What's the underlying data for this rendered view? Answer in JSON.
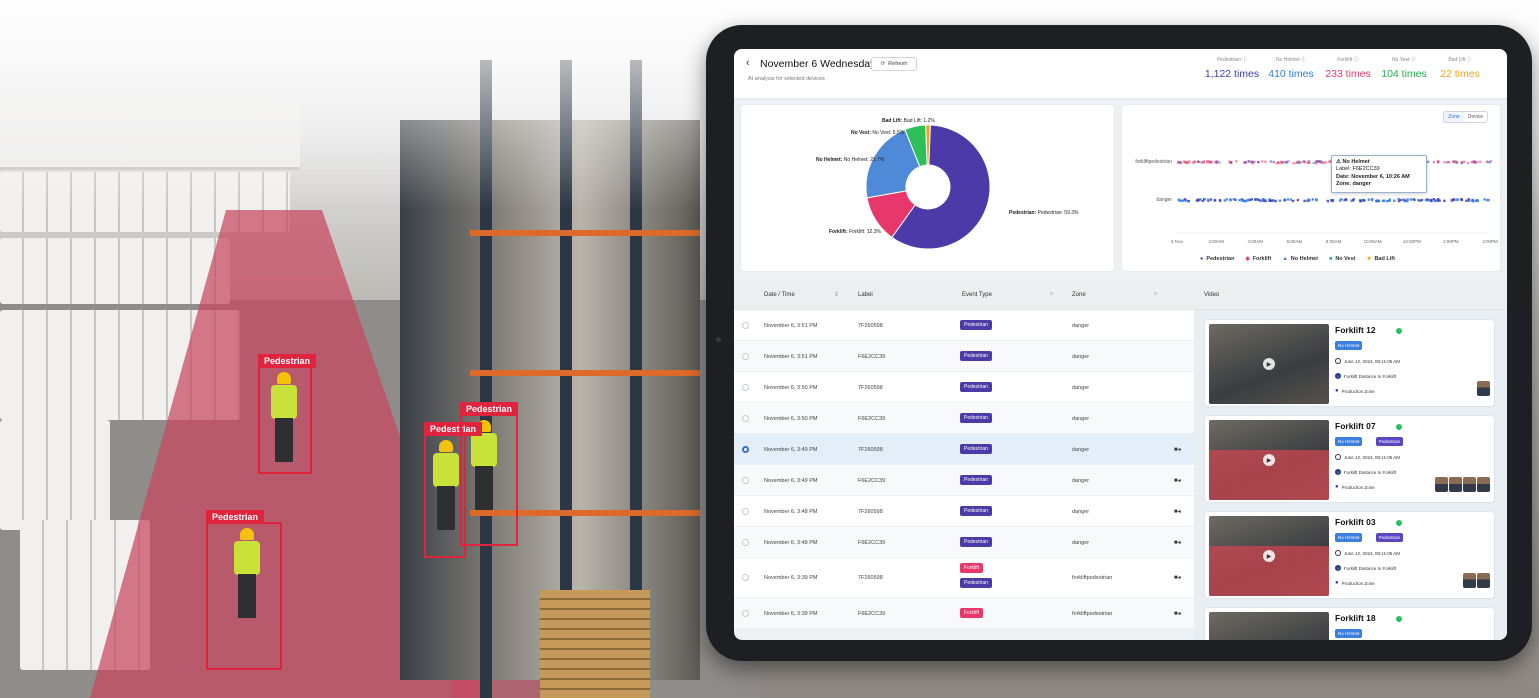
{
  "scene": {
    "detections": [
      {
        "label": "Pedestrian"
      },
      {
        "label": "Pedestrian"
      },
      {
        "label": "Pedestrian"
      },
      {
        "label": "Pedestrian"
      }
    ]
  },
  "header": {
    "back_icon": "chevron-left-icon",
    "title": "November 6 Wednesday",
    "subtitle": "AI analysis for selected devices",
    "refresh_label": "Refresh",
    "stats": [
      {
        "label": "Pedestrian ⓘ",
        "value": "1,122 times",
        "color": "#3a3fae"
      },
      {
        "label": "No Helmet ⓘ",
        "value": "410 times",
        "color": "#2f7fe0"
      },
      {
        "label": "Forklift ⓘ",
        "value": "233 times",
        "color": "#e8376a"
      },
      {
        "label": "No Vest ⓘ",
        "value": "104 times",
        "color": "#22b14c"
      },
      {
        "label": "Bad Lift ⓘ",
        "value": "22 times",
        "color": "#f2a31b"
      }
    ]
  },
  "chart_data": [
    {
      "type": "pie",
      "donut": true,
      "categories": [
        "Pedestrian",
        "Forklift",
        "No Helmet",
        "No Vest",
        "Bad Lift"
      ],
      "values": [
        59.3,
        12.3,
        21.7,
        5.5,
        1.2
      ],
      "labels": [
        "Pedestrian: 59.3%",
        "Forklift: 12.3%",
        "No Helmet: 21.7%",
        "No Vest: 5.5%",
        "Bad Lift: 1.2%"
      ],
      "colors": [
        "#4b3aa8",
        "#e8376a",
        "#4f8ad9",
        "#2fbf5a",
        "#f2a31b"
      ]
    },
    {
      "type": "scatter",
      "rows": [
        "forkliftpedestrian",
        "danger"
      ],
      "x_ticks": [
        "6 Nov",
        "2:00AM",
        "4:00AM",
        "6:00AM",
        "8:00AM",
        "10:00AM",
        "12:00PM",
        "2:00PM",
        "4:00PM"
      ],
      "legend": [
        "Pedestrian",
        "Forklift",
        "No Helmet",
        "No Vest",
        "Bad Lift"
      ],
      "legend_colors": [
        "#4b3aa8",
        "#e8376a",
        "#2f7fe0",
        "#2fbf5a",
        "#f2a31b"
      ],
      "legend_placement": "bottom",
      "toggle": [
        "Zone",
        "Device"
      ],
      "tooltip": {
        "title": "⚠ No Helmet",
        "label": "Label: F6E2CC39",
        "date": "Date: November 6, 10:26 AM",
        "zone": "Zone: danger"
      }
    }
  ],
  "table": {
    "headers": {
      "datetime": "Date / Time",
      "label": "Label",
      "event": "Event Type",
      "zone": "Zone",
      "video": "Video"
    },
    "rows": [
      {
        "datetime": "November 6, 3:51 PM",
        "label": "7F260598",
        "events": [
          "Pedestrian"
        ],
        "zone": "danger",
        "video": false
      },
      {
        "datetime": "November 6, 3:51 PM",
        "label": "F6E2CC39",
        "events": [
          "Pedestrian"
        ],
        "zone": "danger",
        "video": false
      },
      {
        "datetime": "November 6, 3:50 PM",
        "label": "7F260598",
        "events": [
          "Pedestrian"
        ],
        "zone": "danger",
        "video": false
      },
      {
        "datetime": "November 6, 3:50 PM",
        "label": "F6E2CC39",
        "events": [
          "Pedestrian"
        ],
        "zone": "danger",
        "video": false
      },
      {
        "datetime": "November 6, 3:49 PM",
        "label": "7F260598",
        "events": [
          "Pedestrian"
        ],
        "zone": "danger",
        "video": true,
        "selected": true
      },
      {
        "datetime": "November 6, 3:49 PM",
        "label": "F6E2CC39",
        "events": [
          "Pedestrian"
        ],
        "zone": "danger",
        "video": true
      },
      {
        "datetime": "November 6, 3:48 PM",
        "label": "7F260598",
        "events": [
          "Pedestrian"
        ],
        "zone": "danger",
        "video": true
      },
      {
        "datetime": "November 6, 3:48 PM",
        "label": "F6E2CC39",
        "events": [
          "Pedestrian"
        ],
        "zone": "danger",
        "video": true
      },
      {
        "datetime": "November 6, 3:39 PM",
        "label": "7F260598",
        "events": [
          "Forklift",
          "Pedestrian"
        ],
        "zone": "forkliftpedestrian",
        "video": true
      },
      {
        "datetime": "November 6, 3:39 PM",
        "label": "F6E2CC39",
        "events": [
          "Forklift"
        ],
        "zone": "forkliftpedestrian",
        "video": true
      }
    ]
  },
  "videos": [
    {
      "title": "Forklift 12",
      "tags": [
        "No Helmet"
      ],
      "date": "June 12, 2024, 08:11:05 AM",
      "event": "Forklift Distance to Forklift",
      "zone": "Production Zone",
      "avatars": 1
    },
    {
      "title": "Forklift 07",
      "tags": [
        "No Helmet",
        "Pedestrian"
      ],
      "date": "June 12, 2024, 08:11:05 AM",
      "event": "Forklift Distance to Forklift",
      "zone": "Production Zone",
      "avatars": 4
    },
    {
      "title": "Forklift 03",
      "tags": [
        "No Helmet",
        "Pedestrian"
      ],
      "date": "June 12, 2024, 08:11:05 AM",
      "event": "Forklift Distance to Forklift",
      "zone": "Production Zone",
      "avatars": 2
    },
    {
      "title": "Forklift 18",
      "tags": [
        "No Helmet"
      ],
      "date": "",
      "event": "",
      "zone": "",
      "avatars": 0
    }
  ]
}
